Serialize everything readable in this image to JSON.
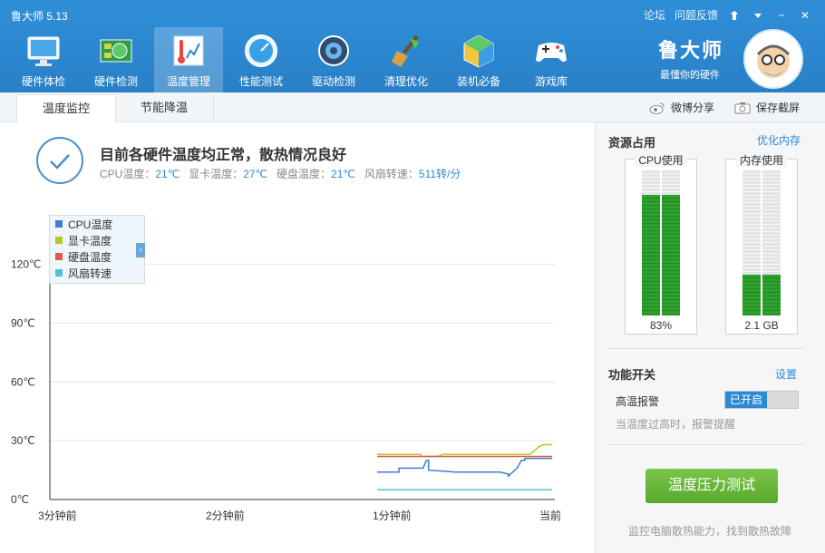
{
  "app": {
    "title": "鲁大师 5.13"
  },
  "topbar": {
    "forum": "论坛",
    "feedback": "问题反馈",
    "skin_icon": "skin-icon",
    "menu_icon": "chevron-down-icon",
    "minimize": "−",
    "close": "✕"
  },
  "nav": {
    "items": [
      {
        "label": "硬件体检",
        "icon": "monitor-icon"
      },
      {
        "label": "硬件检测",
        "icon": "chip-icon"
      },
      {
        "label": "温度管理",
        "icon": "thermometer-icon"
      },
      {
        "label": "性能测试",
        "icon": "gauge-icon"
      },
      {
        "label": "驱动检测",
        "icon": "gear-icon"
      },
      {
        "label": "清理优化",
        "icon": "broom-icon"
      },
      {
        "label": "装机必备",
        "icon": "cube-icon"
      },
      {
        "label": "游戏库",
        "icon": "gamepad-icon"
      }
    ],
    "active": "温度管理"
  },
  "brand": {
    "name": "鲁大师",
    "slogan": "最懂你的硬件"
  },
  "subtabs": {
    "t1": "温度监控",
    "t2": "节能降温",
    "share_weibo": "微博分享",
    "save_screenshot": "保存截屏"
  },
  "status": {
    "title": "目前各硬件温度均正常，散热情况良好",
    "cpu_label": "CPU温度：",
    "cpu_value": "21℃",
    "gpu_label": "显卡温度：",
    "gpu_value": "27℃",
    "disk_label": "硬盘温度：",
    "disk_value": "21℃",
    "fan_label": "风扇转速：",
    "fan_value": "511转/分"
  },
  "chart_data": {
    "type": "line",
    "y_ticks": [
      "0℃",
      "30℃",
      "60℃",
      "90℃",
      "120℃"
    ],
    "ylim": [
      0,
      130
    ],
    "x_ticks": [
      "3分钟前",
      "2分钟前",
      "1分钟前",
      "当前"
    ],
    "legend": [
      "CPU温度",
      "显卡温度",
      "硬盘温度",
      "风扇转速"
    ],
    "series": [
      {
        "name": "CPU温度",
        "color": "#3a7fd0",
        "x": [
          0,
          20,
          20,
          42,
          45,
          47,
          47,
          72,
          92,
          112,
          120,
          120,
          128,
          132,
          135,
          135,
          160
        ],
        "y": [
          14,
          14,
          16,
          16,
          20,
          20,
          15,
          14,
          14,
          14,
          13,
          12,
          16,
          20,
          20,
          21,
          21
        ]
      },
      {
        "name": "显卡温度",
        "color": "#b7c62a",
        "x": [
          0,
          40,
          40,
          56,
          60,
          140,
          144,
          148,
          152,
          160
        ],
        "y": [
          23,
          23,
          22,
          22,
          23,
          23,
          25,
          27,
          28,
          28
        ]
      },
      {
        "name": "硬盘温度",
        "color": "#e05a4a",
        "x": [
          0,
          160
        ],
        "y": [
          22,
          22
        ]
      },
      {
        "name": "风扇转速",
        "color": "#4fc3d6",
        "x": [
          0,
          160
        ],
        "y": [
          5,
          5
        ]
      }
    ]
  },
  "resources": {
    "title": "资源占用",
    "optimize": "优化内存",
    "cpu_label": "CPU使用",
    "cpu_value": "83%",
    "cpu_fraction": 0.83,
    "mem_label": "内存使用",
    "mem_value": "2.1 GB",
    "mem_fraction": 0.28
  },
  "features": {
    "title": "功能开关",
    "settings": "设置",
    "alarm_label": "高温报警",
    "alarm_state": "已开启",
    "hint": "当温度过高时，报警提醒",
    "stress_button": "温度压力测试",
    "footer": "监控电脑散热能力，找到散热故障"
  }
}
